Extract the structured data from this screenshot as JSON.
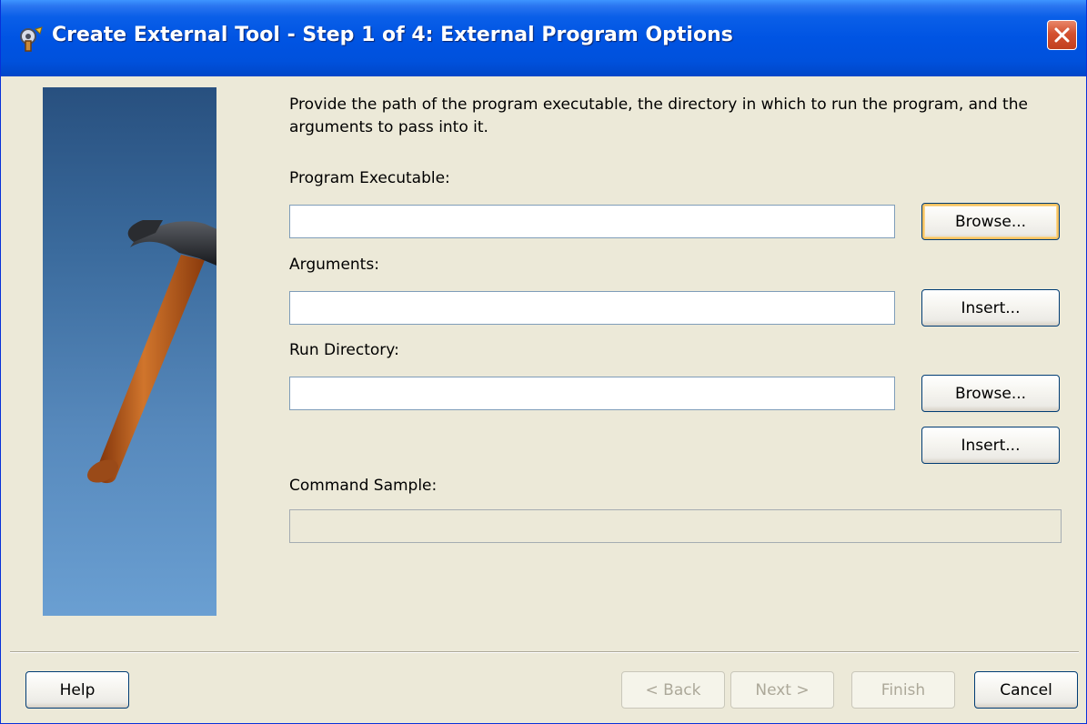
{
  "window": {
    "title": "Create External Tool - Step 1 of 4: External Program Options",
    "close_label": "×"
  },
  "instructions": "Provide the path of the program executable, the directory in which to run the program, and the arguments to pass into it.",
  "fields": {
    "program_executable": {
      "label": "Program Executable:",
      "value": ""
    },
    "arguments": {
      "label": "Arguments:",
      "value": ""
    },
    "run_directory": {
      "label": "Run Directory:",
      "value": ""
    },
    "command_sample": {
      "label": "Command Sample:",
      "value": ""
    }
  },
  "buttons": {
    "browse_executable": "Browse...",
    "insert_arguments": "Insert...",
    "browse_directory": "Browse...",
    "insert_directory": "Insert...",
    "help": "Help",
    "back": "< Back",
    "next": "Next >",
    "finish": "Finish",
    "cancel": "Cancel"
  },
  "colors": {
    "titlebar": "#0054e3",
    "dialog_bg": "#ece9d8",
    "focus_ring": "#f5c261",
    "side_panel": "#3a6a9c"
  },
  "icons": {
    "title": "tool-icon",
    "close": "close-icon",
    "side": "hammer-illustration"
  }
}
